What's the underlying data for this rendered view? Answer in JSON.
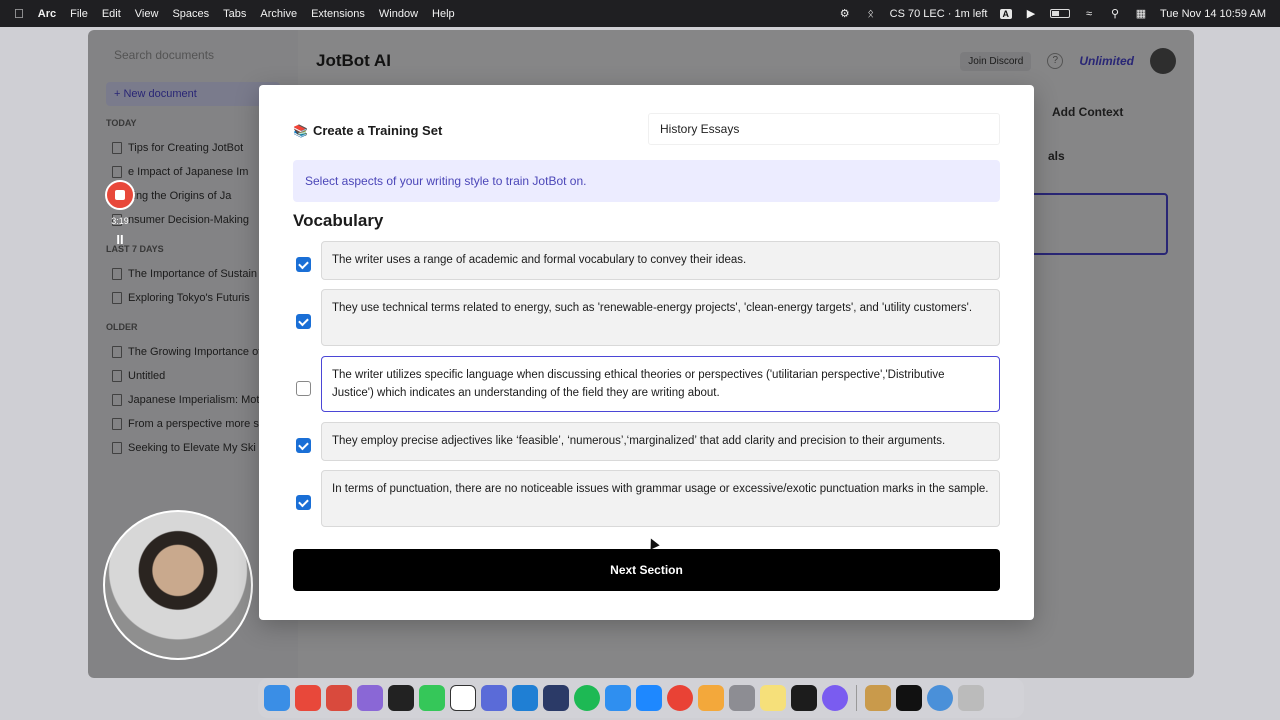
{
  "menubar": {
    "app": "Arc",
    "items": [
      "File",
      "Edit",
      "View",
      "Spaces",
      "Tabs",
      "Archive",
      "Extensions",
      "Window",
      "Help"
    ],
    "calendar": "CS 70 LEC · 1m left",
    "input_source": "A",
    "datetime": "Tue Nov 14  10:59 AM"
  },
  "background_app": {
    "search_placeholder": "Search documents",
    "new_document": "+ New document",
    "brand": "JotBot AI",
    "join_discord": "Join Discord",
    "help": "?",
    "plan": "Unlimited",
    "add_context": "Add Context",
    "panel_fragment": "als",
    "groups": [
      {
        "label": "TODAY",
        "docs": [
          "Tips for Creating JotBot",
          "e Impact of Japanese Im",
          "cing the Origins of Ja",
          "nsumer Decision-Making"
        ]
      },
      {
        "label": "LAST 7 DAYS",
        "docs": [
          "The Importance of Sustain",
          "Exploring Tokyo's Futuris"
        ]
      },
      {
        "label": "OLDER",
        "docs": [
          "The Growing Importance of",
          "Untitled",
          "Japanese Imperialism: Mot",
          "From a perspective more s",
          "Seeking to Elevate My Ski"
        ]
      }
    ]
  },
  "recorder": {
    "time": "3:19",
    "pause": "II"
  },
  "modal": {
    "header_icon": "books-icon",
    "title": "Create a Training Set",
    "set_name_value": "History Essays",
    "banner": "Select aspects of your writing style to train JotBot on.",
    "section_title": "Vocabulary",
    "aspects": [
      {
        "checked": true,
        "text": "The writer uses a range of academic and formal vocabulary to convey their ideas."
      },
      {
        "checked": true,
        "text": "They use technical terms related to energy, such as 'renewable-energy projects', 'clean-energy targets', and 'utility customers'."
      },
      {
        "checked": false,
        "focused": true,
        "text": "The writer utilizes specific language when discussing ethical theories or perspectives ('utilitarian perspective','Distributive Justice') which indicates an understanding of the field they are writing about."
      },
      {
        "checked": true,
        "text": "They employ precise adjectives like ‘feasible’, ‘numerous’,‘marginalized’ that add clarity and precision to their arguments."
      },
      {
        "checked": true,
        "text": "In terms of punctuation, there are no noticeable issues with grammar usage or excessive/exotic punctuation marks in the sample."
      }
    ],
    "next_button": "Next Section"
  },
  "colors": {
    "accent": "#4b46d6",
    "checkbox": "#1a6fd6",
    "banner_bg": "#ececff",
    "record": "#e8483a"
  }
}
